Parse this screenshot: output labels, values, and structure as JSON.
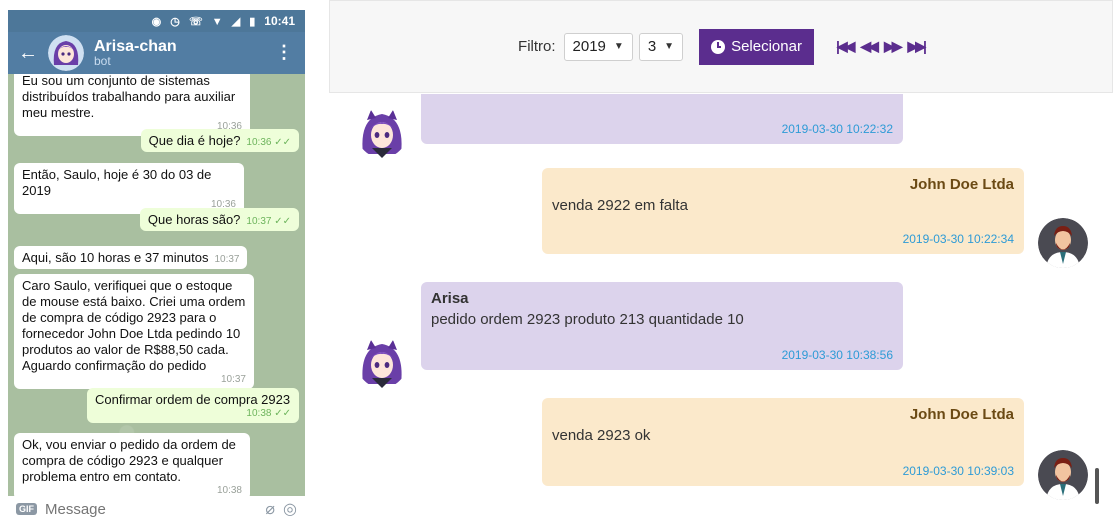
{
  "phone": {
    "status_time": "10:41",
    "header": {
      "name": "Arisa-chan",
      "subtitle": "bot"
    },
    "messages": [
      {
        "dir": "in",
        "text": "Eu sou um conjunto de sistemas distribuídos trabalhando para auxiliar meu mestre.",
        "time": "10:36"
      },
      {
        "dir": "out",
        "text": "Que dia é hoje?",
        "time": "10:36"
      },
      {
        "dir": "in",
        "text": "Então, Saulo, hoje é 30 do 03 de 2019",
        "time": "10:36"
      },
      {
        "dir": "out",
        "text": "Que horas são?",
        "time": "10:37"
      },
      {
        "dir": "in",
        "text": "Aqui, são 10 horas e 37 minutos",
        "time": "10:37"
      },
      {
        "dir": "in",
        "text": "Caro Saulo, verifiquei que o estoque de mouse está baixo. Criei uma ordem de compra de código 2923 para o fornecedor John Doe Ltda pedindo 10 produtos ao valor de R$88,50 cada. Aguardo confirmação do pedido",
        "time": "10:37"
      },
      {
        "dir": "out",
        "text": "Confirmar ordem de compra 2923",
        "time": "10:38"
      },
      {
        "dir": "in",
        "text": "Ok, vou enviar o pedido da ordem de compra de código 2923 e qualquer problema entro em contato.",
        "time": "10:38"
      }
    ],
    "input_placeholder": "Message"
  },
  "web": {
    "filter": {
      "label": "Filtro:",
      "year": "2019",
      "month": "3",
      "button_label": "Selecionar"
    },
    "messages": [
      {
        "from": "bot",
        "name": "",
        "text": "",
        "time": "2019-03-30 10:22:32"
      },
      {
        "from": "user",
        "name": "John Doe Ltda",
        "text": "venda 2922 em falta",
        "time": "2019-03-30 10:22:34"
      },
      {
        "from": "bot",
        "name": "Arisa",
        "text": "pedido ordem 2923 produto 213 quantidade 10",
        "time": "2019-03-30 10:38:56"
      },
      {
        "from": "user",
        "name": "John Doe Ltda",
        "text": "venda 2923 ok",
        "time": "2019-03-30 10:39:03"
      }
    ]
  },
  "colors": {
    "accent": "#5b2d8e",
    "bot_bubble": "#dcd3ec",
    "user_bubble": "#fbe9cb",
    "timestamp": "#2e9bd6",
    "telegram_header": "#527da3"
  },
  "icons": {
    "back": "arrow-left-icon",
    "menu": "more-vertical-icon",
    "clock": "clock-icon",
    "nav": [
      "skip-first-icon",
      "rewind-icon",
      "fast-forward-icon",
      "skip-last-icon"
    ]
  }
}
